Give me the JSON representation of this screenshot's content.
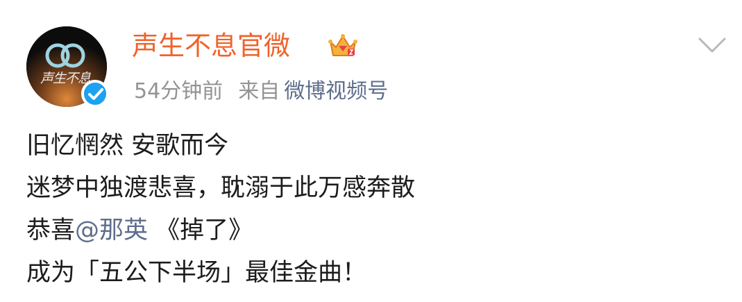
{
  "user": {
    "name": "声生不息官微",
    "avatar_text": "声生不息"
  },
  "meta": {
    "time": "54分钟前",
    "from_label": "来自",
    "source": "微博视频号"
  },
  "content": {
    "line1": "旧忆惘然 安歌而今",
    "line2": "迷梦中独渡悲喜，耽溺于此万感奔散",
    "line3_prefix": "恭喜",
    "mention": "@那英",
    "line3_topic": " 《掉了》",
    "line4": "成为「五公下半场」最佳金曲！"
  },
  "colors": {
    "username": "#f0622a",
    "link": "#5e6e8c",
    "meta_gray": "#939393",
    "verified": "#1da1f2"
  },
  "icons": {
    "crown": "vip-crown-icon",
    "verified": "verified-check-icon",
    "menu": "chevron-down-icon"
  }
}
